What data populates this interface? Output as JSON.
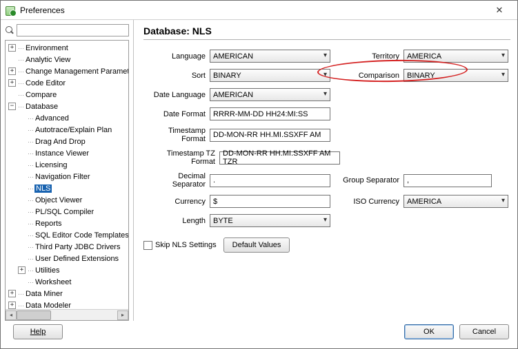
{
  "window": {
    "title": "Preferences"
  },
  "search": {
    "placeholder": ""
  },
  "tree": {
    "items": [
      {
        "label": "Environment",
        "toggle": "+",
        "depth": 0
      },
      {
        "label": "Analytic View",
        "toggle": "",
        "depth": 0
      },
      {
        "label": "Change Management Parameters",
        "toggle": "+",
        "depth": 0
      },
      {
        "label": "Code Editor",
        "toggle": "+",
        "depth": 0
      },
      {
        "label": "Compare",
        "toggle": "",
        "depth": 0
      },
      {
        "label": "Database",
        "toggle": "-",
        "depth": 0
      },
      {
        "label": "Advanced",
        "toggle": "",
        "depth": 1
      },
      {
        "label": "Autotrace/Explain Plan",
        "toggle": "",
        "depth": 1
      },
      {
        "label": "Drag And Drop",
        "toggle": "",
        "depth": 1
      },
      {
        "label": "Instance Viewer",
        "toggle": "",
        "depth": 1
      },
      {
        "label": "Licensing",
        "toggle": "",
        "depth": 1
      },
      {
        "label": "Navigation Filter",
        "toggle": "",
        "depth": 1
      },
      {
        "label": "NLS",
        "toggle": "",
        "depth": 1,
        "selected": true
      },
      {
        "label": "Object Viewer",
        "toggle": "",
        "depth": 1
      },
      {
        "label": "PL/SQL Compiler",
        "toggle": "",
        "depth": 1
      },
      {
        "label": "Reports",
        "toggle": "",
        "depth": 1
      },
      {
        "label": "SQL Editor Code Templates",
        "toggle": "",
        "depth": 1
      },
      {
        "label": "Third Party JDBC Drivers",
        "toggle": "",
        "depth": 1
      },
      {
        "label": "User Defined Extensions",
        "toggle": "",
        "depth": 1
      },
      {
        "label": "Utilities",
        "toggle": "+",
        "depth": 1
      },
      {
        "label": "Worksheet",
        "toggle": "",
        "depth": 1
      },
      {
        "label": "Data Miner",
        "toggle": "+",
        "depth": 0
      },
      {
        "label": "Data Modeler",
        "toggle": "+",
        "depth": 0
      }
    ]
  },
  "main": {
    "title": "Database: NLS",
    "labels": {
      "language": "Language",
      "territory": "Territory",
      "sort": "Sort",
      "comparison": "Comparison",
      "date_language": "Date Language",
      "date_format": "Date Format",
      "timestamp_format": "Timestamp Format",
      "timestamp_tz_format": "Timestamp TZ Format",
      "decimal_sep": "Decimal Separator",
      "group_sep": "Group Separator",
      "currency": "Currency",
      "iso_currency": "ISO Currency",
      "length": "Length",
      "skip": "Skip NLS Settings",
      "defaults": "Default Values"
    },
    "values": {
      "language": "AMERICAN",
      "territory": "AMERICA",
      "sort": "BINARY",
      "comparison": "BINARY",
      "date_language": "AMERICAN",
      "date_format": "RRRR-MM-DD HH24:MI:SS",
      "timestamp_format": "DD-MON-RR HH.MI.SSXFF AM",
      "timestamp_tz_format": "DD-MON-RR HH.MI.SSXFF AM TZR",
      "decimal_sep": ".",
      "group_sep": ",",
      "currency": "$",
      "iso_currency": "AMERICA",
      "length": "BYTE"
    }
  },
  "footer": {
    "help": "Help",
    "ok": "OK",
    "cancel": "Cancel"
  }
}
